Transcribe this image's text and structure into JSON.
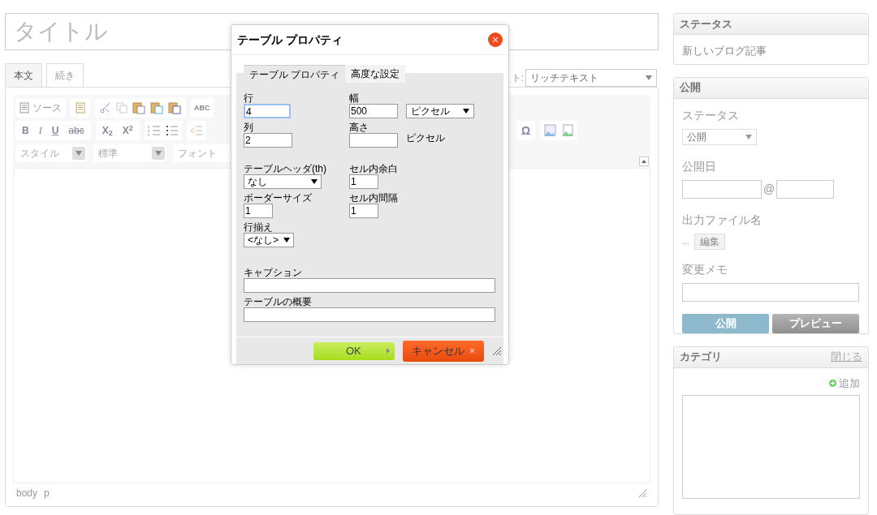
{
  "title_field": {
    "placeholder": "タイトル"
  },
  "editor_tabs": [
    {
      "label": "本文",
      "selected": true
    },
    {
      "label": "続き",
      "selected": false
    }
  ],
  "format_select": {
    "label": "ト:",
    "value": "リッチテキスト"
  },
  "toolbar": {
    "source": "ソース",
    "text_buttons": [
      "B",
      "I",
      "U",
      "abc",
      "X$_{2}$",
      "X$^{2}$"
    ],
    "spell": "ABC",
    "omega": "Ω",
    "combos": [
      "スタイル",
      "標準",
      "フォント"
    ]
  },
  "status_path": [
    "body",
    "p"
  ],
  "dialog": {
    "title": "テーブル プロパティ",
    "tabs": [
      {
        "label": "テーブル プロパティ",
        "selected": true
      },
      {
        "label": "高度な設定",
        "selected": false
      }
    ],
    "left_fields": [
      {
        "label": "行",
        "kind": "input",
        "value": "4",
        "focused": true
      },
      {
        "label": "列",
        "kind": "input",
        "value": "2",
        "focused": false
      },
      {
        "label": "テーブルヘッダ(th)",
        "kind": "select",
        "value": "なし"
      },
      {
        "label": "ボーダーサイズ",
        "kind": "input",
        "value": "1",
        "focused": false
      },
      {
        "label": "行揃え",
        "kind": "select",
        "value": "<なし>"
      }
    ],
    "right_fields": [
      {
        "label": "幅",
        "kind": "input",
        "value": "500",
        "focused": false,
        "unit": {
          "kind": "select",
          "value": "ピクセル"
        }
      },
      {
        "label": "高さ",
        "kind": "input",
        "focused": false,
        "unit": {
          "kind": "text",
          "value": "ピクセル"
        }
      },
      {
        "label": "セル内余白",
        "kind": "input",
        "value": "1",
        "focused": false
      },
      {
        "label": "セル内間隔",
        "kind": "input",
        "value": "1",
        "focused": false
      }
    ],
    "wide_fields": [
      {
        "label": "キャプション"
      },
      {
        "label": "テーブルの概要"
      }
    ],
    "ok_button": "OK",
    "cancel_button": "キャンセル"
  },
  "sidebar": {
    "status_panel": {
      "title": "ステータス",
      "text": "新しいブログ記事"
    },
    "publish_panel": {
      "title": "公開",
      "status_label": "ステータス",
      "status_value": "公開",
      "date_label": "公開日",
      "at": "@",
      "filename_label": "出力ファイル名",
      "filename_value": "...",
      "edit_button": "編集",
      "memo_label": "変更メモ",
      "publish_button": "公開",
      "preview_button": "プレビュー"
    },
    "category_panel": {
      "title": "カテゴリ",
      "close_link": "閉じる",
      "add_link": "追加"
    }
  }
}
